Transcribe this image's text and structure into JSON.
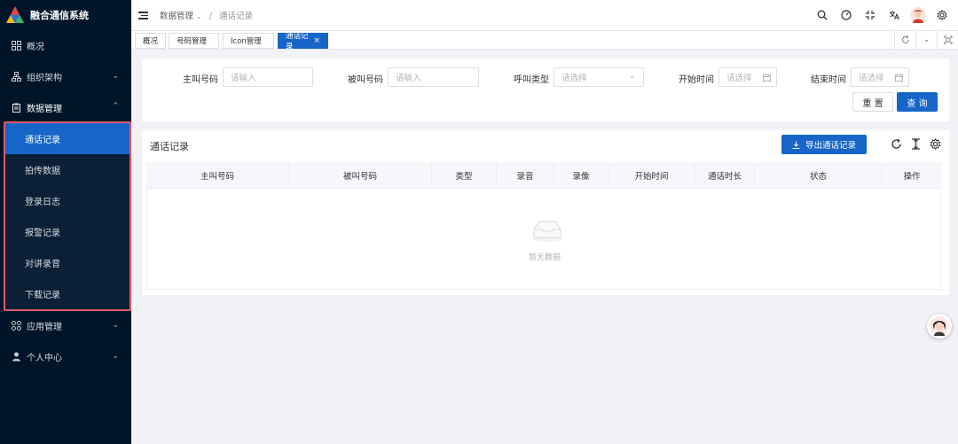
{
  "app": {
    "title": "融合通信系统"
  },
  "sidebar": {
    "items": [
      {
        "label": "概况",
        "icon": "grid-icon"
      },
      {
        "label": "组织架构",
        "icon": "org-icon"
      },
      {
        "label": "数据管理",
        "icon": "clipboard-icon"
      },
      {
        "label": "应用管理",
        "icon": "apps-icon"
      },
      {
        "label": "个人中心",
        "icon": "user-icon"
      }
    ],
    "submenu": [
      {
        "label": "通话记录",
        "active": true
      },
      {
        "label": "拍传数据"
      },
      {
        "label": "登录日志"
      },
      {
        "label": "报警记录"
      },
      {
        "label": "对讲录音"
      },
      {
        "label": "下载记录"
      }
    ]
  },
  "header": {
    "breadcrumb": {
      "parent": "数据管理",
      "sep": "/",
      "current": "通话记录"
    }
  },
  "tags": [
    {
      "label": "概况"
    },
    {
      "label": "号码管理"
    },
    {
      "label": "Icon管理"
    },
    {
      "label": "通话记录",
      "active": true,
      "close": "×"
    }
  ],
  "search": {
    "caller": {
      "label": "主叫号码",
      "placeholder": "请输入"
    },
    "callee": {
      "label": "被叫号码",
      "placeholder": "请输入"
    },
    "type": {
      "label": "呼叫类型",
      "placeholder": "请选择"
    },
    "start": {
      "label": "开始时间",
      "placeholder": "请选择"
    },
    "end": {
      "label": "结束时间",
      "placeholder": "请选择"
    },
    "reset": "重 置",
    "query": "查 询"
  },
  "table": {
    "title": "通话记录",
    "export": "导出通话记录",
    "columns": [
      "主叫号码",
      "被叫号码",
      "类型",
      "录音",
      "录像",
      "开始时间",
      "通话时长",
      "状态",
      "操作"
    ],
    "empty": "暂无数据"
  },
  "colors": {
    "primary": "#1765c8",
    "sidebar": "#001529",
    "highlight": "#e05a6a"
  }
}
